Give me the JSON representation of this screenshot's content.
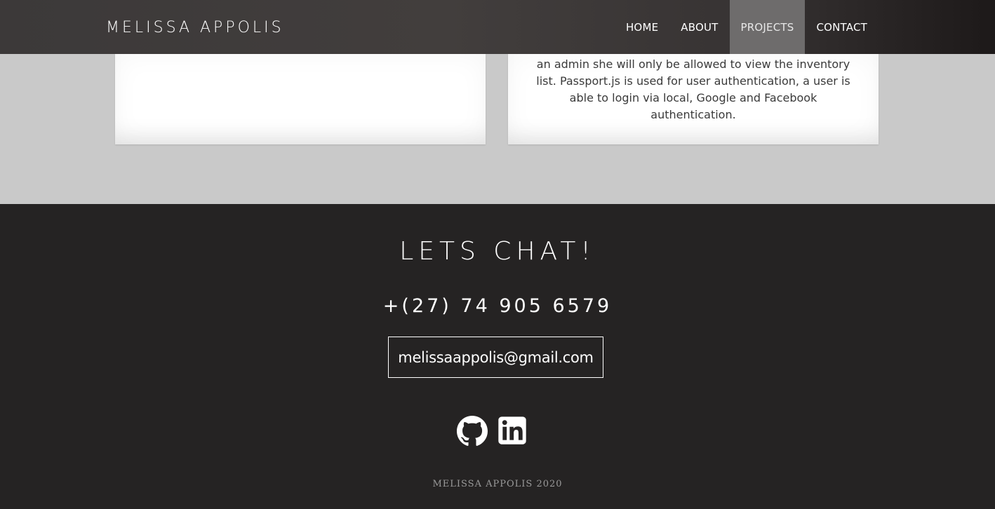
{
  "header": {
    "brand": "MELISSA APPOLIS",
    "nav": [
      {
        "label": "HOME"
      },
      {
        "label": "ABOUT"
      },
      {
        "label": "PROJECTS"
      },
      {
        "label": "CONTACT"
      }
    ],
    "active_nav": "PROJECTS",
    "active_color": "#6e6c6c"
  },
  "projects": {
    "right_card": {
      "lines": [
        "an admin she will only be allowed to view the inventory",
        "list. Passport.js is used for user authentication, a user is",
        "able to login via local, Google and Facebook",
        "authentication."
      ]
    }
  },
  "contact": {
    "heading": "LETS CHAT!",
    "phone": "+(27) 74 905 6579",
    "email": "melissaappolis@gmail.com",
    "social": [
      {
        "name": "github-icon"
      },
      {
        "name": "linkedin-icon"
      }
    ],
    "copyright": "MELISSA APPOLIS 2020"
  },
  "colors": {
    "page_bg": "#c9c9c9",
    "footer_bg": "#252323",
    "text_light": "#ffffff"
  }
}
